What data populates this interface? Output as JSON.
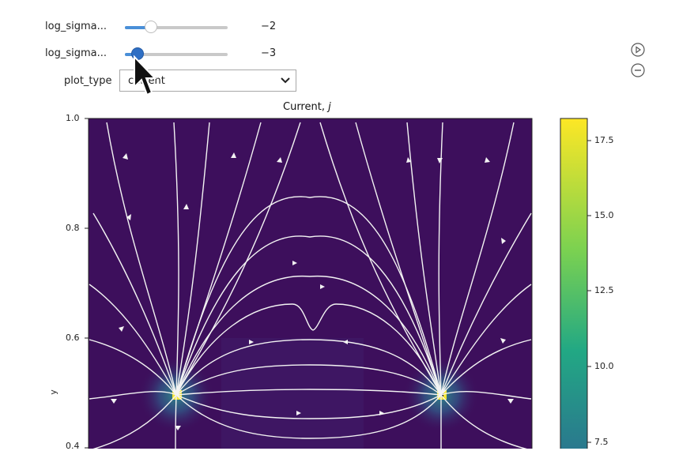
{
  "widgets": {
    "slider1": {
      "label": "log_sigma...",
      "value_text": "−2",
      "value_fraction": 0.25
    },
    "slider2": {
      "label": "log_sigma...",
      "value_text": "−3",
      "value_fraction": 0.12
    },
    "plot_type": {
      "label": "plot_type",
      "selected": "current"
    }
  },
  "side_controls": {
    "play_icon": "play-icon",
    "minus_icon": "minus-icon"
  },
  "plot": {
    "title": "Current, ",
    "title_italic": "j",
    "ylabel": "y"
  },
  "chart_data": {
    "type": "heatmap",
    "title": "Current, j",
    "ylabel": "y",
    "y_ticks": [
      "1.0",
      "0.8",
      "0.6",
      "0.4"
    ],
    "ylim": [
      0.4,
      1.0
    ],
    "colorbar_ticks": [
      "17.5",
      "15.0",
      "12.5",
      "10.0",
      "7.5"
    ],
    "colorbar_range": [
      7.5,
      17.5
    ],
    "colormap": "viridis",
    "colors": {
      "background": "#3d0f5c",
      "line": "#ffffff",
      "hot": "#f3e535"
    }
  }
}
